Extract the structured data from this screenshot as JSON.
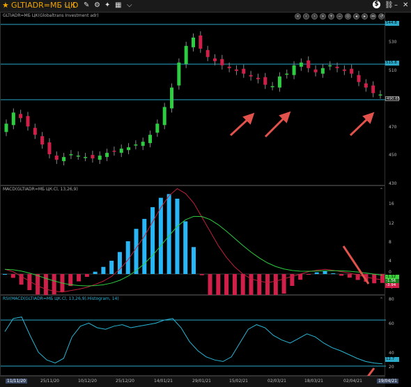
{
  "toolbar": {
    "symbol": "GLTIADR=МБ ЦК",
    "period": "D"
  },
  "price_panel": {
    "label": "GLTIADR=МБ ЦК(Globaltrans Investment adr)",
    "ticks": [
      "530",
      "510",
      "490",
      "470",
      "450",
      "430"
    ],
    "badges": {
      "top": "544.8",
      "mid": "515.8",
      "last": "490.65"
    }
  },
  "macd_panel": {
    "label": "MACD(GLTIADR=МБ ЦК.Cl, 13,26,9)",
    "ticks": [
      "16",
      "12",
      "8",
      "4",
      "0",
      "-4"
    ],
    "badges": {
      "a": "-1.12",
      "b": "-1.56",
      "c": "-3.94"
    }
  },
  "rsi_panel": {
    "label": "RSI(MACD(GLTIADR=МБ ЦК.Cl, 13,26,9).Histogram, 14)",
    "ticks": [
      "80",
      "60",
      "40",
      "20"
    ],
    "badges": {
      "last": "12.7"
    }
  },
  "x_axis": {
    "labels": [
      "11/11/20",
      "25/11/20",
      "10/12/20",
      "25/12/20",
      "14/01/21",
      "29/01/21",
      "15/02/21",
      "02/03/21",
      "18/03/21",
      "02/04/21",
      "19/04/21"
    ]
  },
  "chart_data": {
    "type": "candlestick",
    "price_closes": [
      470,
      478,
      474,
      468,
      462,
      455,
      448,
      444,
      446,
      448,
      447,
      446,
      445,
      447,
      449,
      450,
      452,
      453,
      455,
      457,
      462,
      470,
      482,
      496,
      514,
      526,
      532,
      524,
      518,
      515,
      512,
      510,
      508,
      506,
      504,
      502,
      498,
      497,
      504,
      506,
      512,
      514,
      510,
      507,
      510,
      512,
      510,
      508,
      506,
      500,
      496,
      492,
      491
    ],
    "macd_line": [
      1,
      0.5,
      -0.5,
      -1.5,
      -2.5,
      -3.2,
      -3.6,
      -3.8,
      -3.5,
      -3.2,
      -2.8,
      -2.2,
      -1.5,
      -0.5,
      1,
      3,
      5.5,
      8,
      11,
      14,
      16.5,
      18,
      17,
      15,
      12,
      9,
      6,
      3.5,
      1.5,
      0,
      -1,
      -1.5,
      -1.8,
      -1.5,
      -1,
      -0.5,
      0,
      0.5,
      0.8,
      1,
      0.8,
      0.5,
      0.2,
      -0.2,
      -0.6,
      -1,
      -1.2
    ],
    "rsi": [
      55,
      72,
      74,
      50,
      28,
      18,
      14,
      20,
      48,
      62,
      66,
      60,
      58,
      62,
      64,
      60,
      62,
      64,
      66,
      70,
      72,
      60,
      42,
      30,
      22,
      18,
      16,
      22,
      40,
      58,
      64,
      60,
      50,
      44,
      40,
      46,
      52,
      48,
      40,
      34,
      30,
      25,
      20,
      16,
      14,
      13
    ]
  }
}
